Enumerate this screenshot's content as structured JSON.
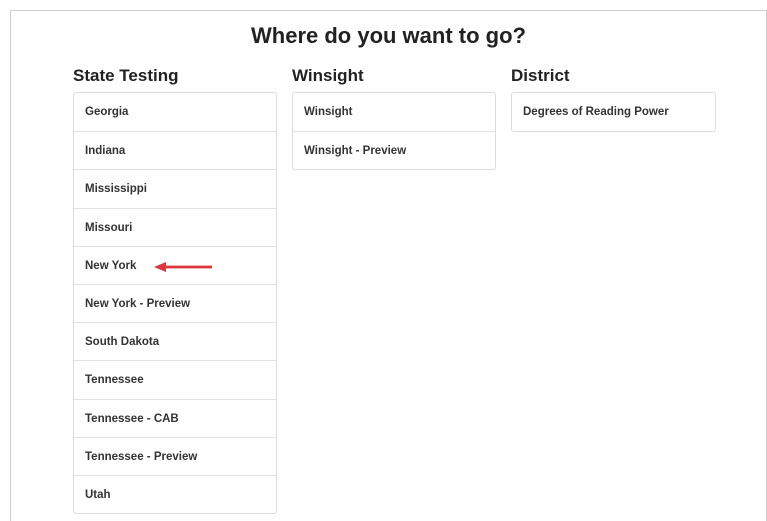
{
  "page": {
    "title": "Where do you want to go?"
  },
  "columns": {
    "state_testing": {
      "title": "State Testing",
      "items": [
        "Georgia",
        "Indiana",
        "Mississippi",
        "Missouri",
        "New York",
        "New York - Preview",
        "South Dakota",
        "Tennessee",
        "Tennessee - CAB",
        "Tennessee - Preview",
        "Utah"
      ]
    },
    "winsight": {
      "title": "Winsight",
      "items": [
        "Winsight",
        "Winsight - Preview"
      ]
    },
    "district": {
      "title": "District",
      "items": [
        "Degrees of Reading Power"
      ]
    }
  },
  "annotation": {
    "arrow_color": "#e0353b",
    "pointing_at": "New York",
    "icon": "left-arrow-icon"
  },
  "colors": {
    "border": "#dddddd",
    "text": "#333333"
  }
}
